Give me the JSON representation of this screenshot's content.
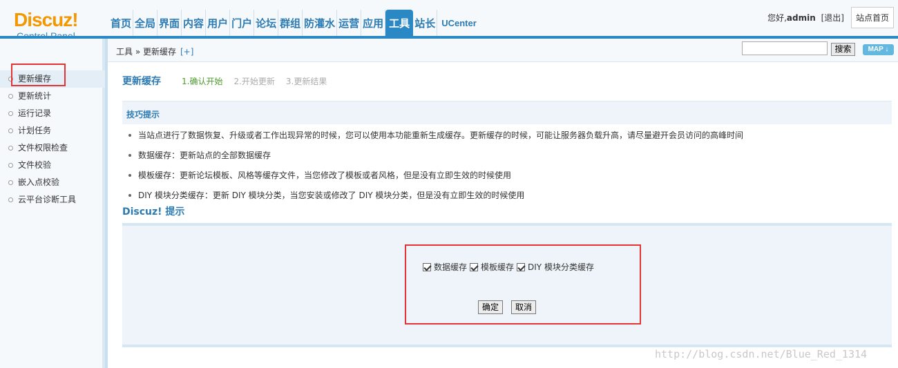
{
  "logo": {
    "brand": "Discuz!",
    "sub": "Control Panel"
  },
  "nav": {
    "items": [
      "首页",
      "全局",
      "界面",
      "内容",
      "用户",
      "门户",
      "论坛",
      "群组",
      "防灌水",
      "运营",
      "应用",
      "工具",
      "站长",
      "UCenter"
    ],
    "active": "工具"
  },
  "topright": {
    "greeting": "您好,",
    "user": "admin",
    "logout": "[退出]",
    "site_home": "站点首页"
  },
  "breadcrumb": {
    "path": "工具 » 更新缓存",
    "add": "[+]"
  },
  "search": {
    "value": "",
    "button": "搜索",
    "map": "MAP ↓"
  },
  "sidebar": {
    "items": [
      "更新缓存",
      "更新统计",
      "运行记录",
      "计划任务",
      "文件权限检查",
      "文件校验",
      "嵌入点校验",
      "云平台诊断工具"
    ],
    "active": "更新缓存"
  },
  "main": {
    "title": "更新缓存",
    "steps": [
      "1.确认开始",
      "2.开始更新",
      "3.更新结果"
    ],
    "tips_title": "技巧提示",
    "tips": [
      "当站点进行了数据恢复、升级或者工作出现异常的时候，您可以使用本功能重新生成缓存。更新缓存的时候，可能让服务器负载升高，请尽量避开会员访问的高峰时间",
      "数据缓存：更新站点的全部数据缓存",
      "模板缓存：更新论坛模板、风格等缓存文件，当您修改了模板或者风格，但是没有立即生效的时候使用",
      "DIY 模块分类缓存：更新 DIY 模块分类，当您安装或修改了 DIY 模块分类，但是没有立即生效的时候使用"
    ],
    "discuz_title": "Discuz! 提示",
    "options": [
      {
        "label": "数据缓存",
        "checked": true
      },
      {
        "label": "模板缓存",
        "checked": true
      },
      {
        "label": "DIY 模块分类缓存",
        "checked": true
      }
    ],
    "confirm": "确定",
    "cancel": "取消"
  },
  "watermark": "http://blog.csdn.net/Blue_Red_1314"
}
